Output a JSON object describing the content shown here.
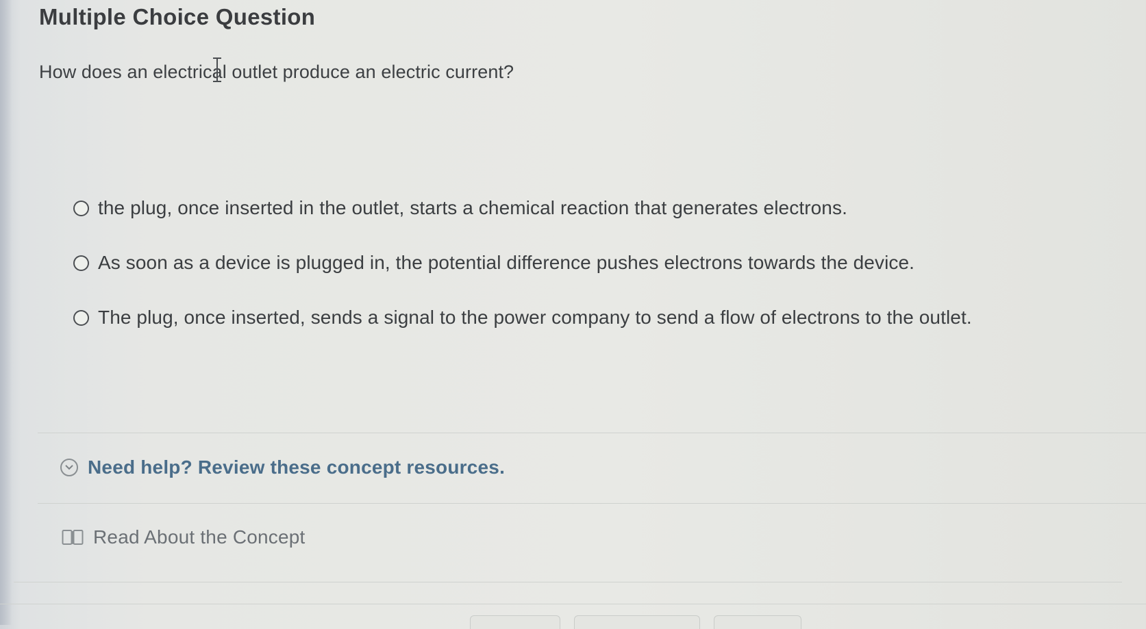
{
  "header": {
    "title": "Multiple Choice Question"
  },
  "question": {
    "text": "How does an electrical outlet produce an electric current?"
  },
  "options": [
    {
      "label": "the plug, once inserted in the outlet, starts a chemical reaction that generates electrons.",
      "selected": false
    },
    {
      "label": "As soon as a device is plugged in, the potential difference pushes electrons towards the device.",
      "selected": false
    },
    {
      "label": "The plug, once inserted, sends a signal to the power company to send a flow of electrons to the outlet.",
      "selected": false
    }
  ],
  "help": {
    "label": "Need help? Review these concept resources.",
    "icon": "chevron-down-circle-icon",
    "color": "#4a6d8a"
  },
  "resources": {
    "read_label": "Read About the Concept",
    "icon": "book-icon"
  }
}
